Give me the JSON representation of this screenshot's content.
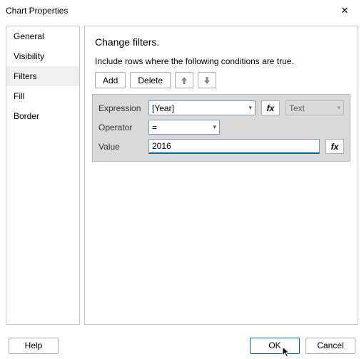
{
  "window": {
    "title": "Chart Properties"
  },
  "sidebar": {
    "items": [
      {
        "label": "General"
      },
      {
        "label": "Visibility"
      },
      {
        "label": "Filters"
      },
      {
        "label": "Fill"
      },
      {
        "label": "Border"
      }
    ],
    "selected_index": 2
  },
  "main": {
    "heading": "Change filters.",
    "caption": "Include rows where the following conditions are true.",
    "buttons": {
      "add": "Add",
      "delete": "Delete"
    },
    "editor": {
      "expression_label": "Expression",
      "expression_value": "[Year]",
      "type_value": "Text",
      "operator_label": "Operator",
      "operator_value": "=",
      "value_label": "Value",
      "value_value": "2016"
    }
  },
  "footer": {
    "help": "Help",
    "ok": "OK",
    "cancel": "Cancel"
  },
  "icons": {
    "fx": "fx",
    "close": "✕"
  }
}
